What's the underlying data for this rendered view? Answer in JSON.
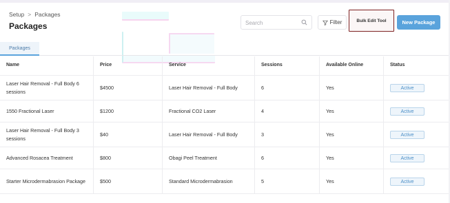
{
  "breadcrumb": {
    "parent": "Setup",
    "separator": ">",
    "current": "Packages"
  },
  "page_title": "Packages",
  "search": {
    "placeholder": "Search",
    "value": ""
  },
  "toolbar": {
    "filter_label": "Filter",
    "bulk_edit_label": "Bulk Edit Tool",
    "new_package_label": "New Package"
  },
  "tabs": [
    {
      "label": "Packages",
      "active": true
    }
  ],
  "table": {
    "columns": [
      "Name",
      "Price",
      "Service",
      "Sessions",
      "Available Online",
      "Status"
    ],
    "rows": [
      {
        "name": "Laser Hair Removal - Full Body 6 sessions",
        "price": "$4500",
        "service": "Laser Hair Removal - Full Body",
        "sessions": "6",
        "online": "Yes",
        "status": "Active"
      },
      {
        "name": "1550 Fractional Laser",
        "price": "$1200",
        "service": "Fractional CO2 Laser",
        "sessions": "4",
        "online": "Yes",
        "status": "Active"
      },
      {
        "name": "Laser Hair Removal - Full Body 3 sessions",
        "price": "$40",
        "service": "Laser Hair Removal - Full Body",
        "sessions": "3",
        "online": "Yes",
        "status": "Active"
      },
      {
        "name": "Advanced Rosacea Treatment",
        "price": "$800",
        "service": "Obagi Peel Treatment",
        "sessions": "6",
        "online": "Yes",
        "status": "Active"
      },
      {
        "name": "Starter Microdermabrasion Package",
        "price": "$500",
        "service": "Standard Microdermabrasion",
        "sessions": "5",
        "online": "Yes",
        "status": "Active"
      }
    ]
  },
  "colors": {
    "accent": "#5aa3dc",
    "bulk_border": "#7d2020",
    "status_text": "#4c8fc7"
  },
  "icons": {
    "search": "search-icon",
    "filter": "filter-icon"
  }
}
